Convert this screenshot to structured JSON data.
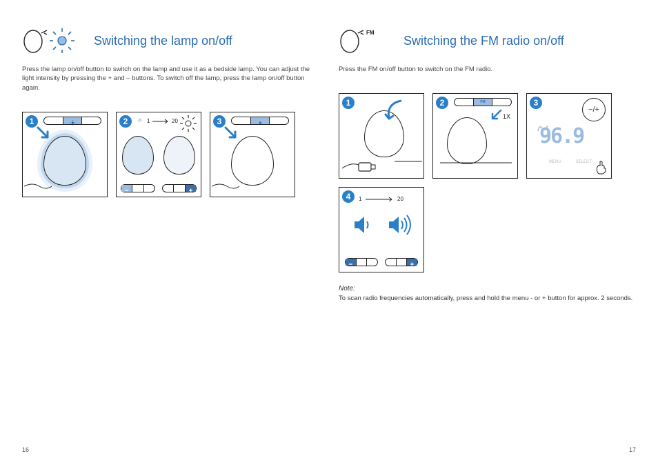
{
  "left": {
    "title": "Switching the lamp on/off",
    "intro": "Press the lamp on/off button to switch on the lamp and use it as a bedside lamp. You can adjust the light intensity by pressing the + and – buttons. To switch off the lamp, press the lamp on/off button again.",
    "icon_labels": {
      "sun": "sun-icon",
      "egg": "egg-icon"
    },
    "steps": [
      {
        "num": "1"
      },
      {
        "num": "2",
        "range_min": "1",
        "range_max": "20"
      },
      {
        "num": "3"
      }
    ],
    "page_number": "16"
  },
  "right": {
    "title": "Switching the FM radio on/off",
    "intro": "Press the FM on/off button to switch on the FM radio.",
    "fm_label": "FM",
    "steps": [
      {
        "num": "1"
      },
      {
        "num": "2",
        "fm": "FM",
        "press": "1X"
      },
      {
        "num": "3",
        "freq": "96.9",
        "pm": "−/+",
        "menu": "MENU",
        "select": "SELECT"
      },
      {
        "num": "4",
        "range_min": "1",
        "range_max": "20"
      }
    ],
    "note_label": "Note:",
    "note_body": "To scan radio frequencies automatically, press and hold the menu - or + button for approx. 2 seconds.",
    "page_number": "17"
  }
}
